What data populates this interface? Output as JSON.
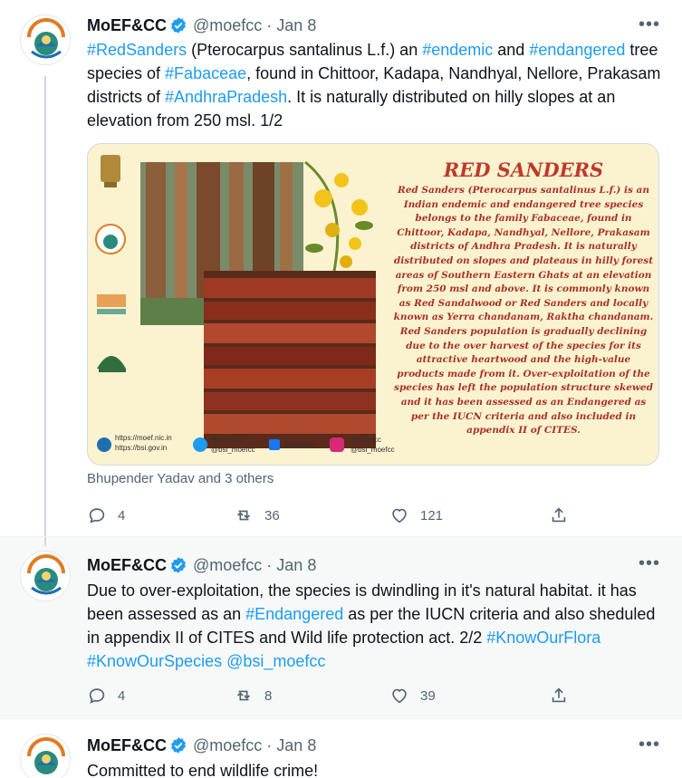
{
  "colors": {
    "link": "#1d9bf0",
    "verified": "#1d9bf0",
    "muted": "#536471",
    "poster_bg": "#fbf3cf",
    "poster_title": "#c0392b",
    "poster_text": "#a93226"
  },
  "tweets": [
    {
      "name": "MoEF&CC",
      "handle": "@moefcc",
      "dot": "·",
      "date": "Jan 8",
      "more": "•••",
      "text_parts": [
        {
          "t": "#RedSanders",
          "tag": true
        },
        {
          "t": " (Pterocarpus santalinus L.f.) an ",
          "tag": false
        },
        {
          "t": "#endemic",
          "tag": true
        },
        {
          "t": " and ",
          "tag": false
        },
        {
          "t": "#endangered",
          "tag": true
        },
        {
          "t": " tree species of  ",
          "tag": false
        },
        {
          "t": "#Fabaceae",
          "tag": true
        },
        {
          "t": ", found in Chittoor, Kadapa, Nandhyal, Nellore, Prakasam districts of ",
          "tag": false
        },
        {
          "t": "#AndhraPradesh",
          "tag": true
        },
        {
          "t": ". It is naturally distributed on hilly slopes at an elevation from 250 msl. 1/2",
          "tag": false
        }
      ],
      "liked_by": "Bhupender Yadav and 3 others",
      "replies": "4",
      "retweets": "36",
      "likes": "121"
    },
    {
      "name": "MoEF&CC",
      "handle": "@moefcc",
      "dot": "·",
      "date": "Jan 8",
      "more": "•••",
      "text_parts": [
        {
          "t": "Due to over-exploitation, the species is dwindling in it's natural habitat.  it has been assessed as an ",
          "tag": false
        },
        {
          "t": "#Endangered",
          "tag": true
        },
        {
          "t": " as per the IUCN criteria and also sheduled in appendix II of CITES and Wild life protection act. 2/2 ",
          "tag": false
        },
        {
          "t": "#KnowOurFlora",
          "tag": true
        },
        {
          "t": "  ",
          "tag": false
        },
        {
          "t": "#KnowOurSpecies",
          "tag": true
        },
        {
          "t": " ",
          "tag": false
        },
        {
          "t": "@bsi_moefcc",
          "tag": true
        }
      ],
      "replies": "4",
      "retweets": "8",
      "likes": "39"
    },
    {
      "name": "MoEF&CC",
      "handle": "@moefcc",
      "dot": "·",
      "date": "Jan 8",
      "more": "•••",
      "text_parts": [
        {
          "t": "Committed to end wildlife crime!",
          "tag": false
        }
      ]
    }
  ],
  "poster": {
    "title": "RED SANDERS",
    "body": "Red Sanders (Pterocarpus santalinus L.f.) is an Indian endemic and endangered tree species belongs to the family Fabaceae, found in Chittoor, Kadapa, Nandhyal, Nellore, Prakasam districts of Andhra Pradesh. It is naturally distributed on slopes and plateaus in hilly forest areas of Southern Eastern Ghats at an elevation from 250 msl and above. It is commonly known as Red Sandalwood or Red Sanders and locally known as Yerra chandanam, Raktha chandanam. Red Sanders population is gradually declining due to the over harvest of the species for its attractive heartwood and the high-value products made from it. Over-exploitation of the species has left the population structure skewed and it has been assessed as an Endangered as per the IUCN criteria and also included in appendix II of CITES.",
    "url1": "https://moef.nic.in",
    "url2": "https://bsi.gov.in",
    "twitter1": "@moefcc",
    "twitter2": "@bsi_moefcc",
    "facebook": "@moefcc",
    "instagram1": "@moefcc",
    "instagram2": "@bsi_moefcc",
    "icons": [
      "national-emblem-icon",
      "moefcc-logo-icon",
      "azadi-ka-amrit-mahotsav-logo",
      "bsi-logo-icon",
      "globe-icon",
      "twitter-icon",
      "facebook-icon",
      "instagram-icon"
    ]
  }
}
